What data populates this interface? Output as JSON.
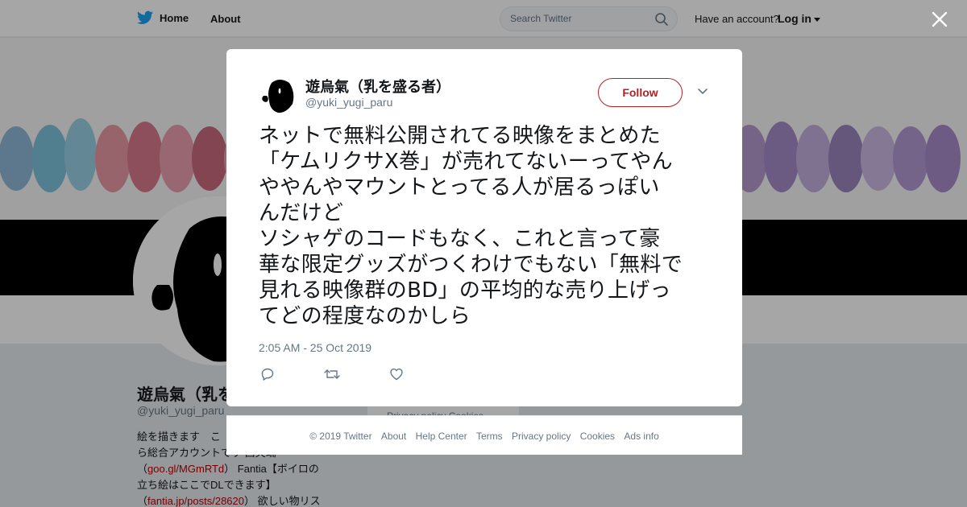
{
  "topbar": {
    "home_label": "Home",
    "about_label": "About",
    "search_placeholder": "Search Twitter",
    "have_account": "Have an account?",
    "login_label": "Log in"
  },
  "profile": {
    "name": "遊烏氣（乳を",
    "handle": "@yuki_yugi_paru",
    "bio": [
      {
        "text": "絵を描きます　こ",
        "link": false
      },
      {
        "text": "ら総合アカウントです 西央端",
        "link": false
      },
      {
        "text": "（",
        "link": false
      },
      {
        "text": "goo.gl/MGmRTd",
        "link": true
      },
      {
        "text": "） Fantia【ボイロの",
        "link": false
      },
      {
        "text": "立ち絵はここでDLできます】",
        "link": false
      },
      {
        "text": "（",
        "link": false
      },
      {
        "text": "fantia.jp/posts/28620",
        "link": true
      },
      {
        "text": "） 欲しい物リス",
        "link": false
      }
    ],
    "footer_partial": "Privacy policy   Cookies"
  },
  "tweet": {
    "author_name": "遊烏氣（乳を盛る者）",
    "author_handle": "@yuki_yugi_paru",
    "follow_label": "Follow",
    "text": "ネットで無料公開されてる映像をまとめた\n「ケムリクサX巻」が売れてないーってやん\nややんやマウントとってる人が居るっぽい\nんだけど\nソシャゲのコードもなく、これと言って豪\n華な限定グッズがつくわけでもない「無料で\n見れる映像群のBD」の平均的な売り上げっ\nてどの程度なのかしら",
    "timestamp": "2:05 AM - 25 Oct 2019"
  },
  "footer": {
    "copyright": "© 2019 Twitter",
    "links": [
      "About",
      "Help Center",
      "Terms",
      "Privacy policy",
      "Cookies",
      "Ads info"
    ]
  },
  "colors": {
    "accent": "#b22222",
    "secondary_text": "#657786",
    "twitter_blue": "#1da1f2"
  }
}
